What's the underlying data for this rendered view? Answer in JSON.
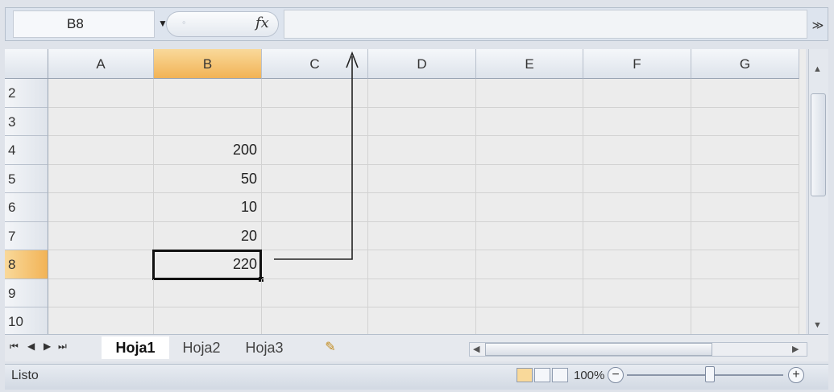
{
  "formula_bar": {
    "name_box": "B8",
    "fx_label": "fx",
    "formula": "",
    "expand": "≫"
  },
  "columns": [
    "A",
    "B",
    "C",
    "D",
    "E",
    "F",
    "G"
  ],
  "selected_column": "B",
  "rows": [
    {
      "num": "2",
      "b": ""
    },
    {
      "num": "3",
      "b": ""
    },
    {
      "num": "4",
      "b": "200"
    },
    {
      "num": "5",
      "b": "50"
    },
    {
      "num": "6",
      "b": "10"
    },
    {
      "num": "7",
      "b": "20"
    },
    {
      "num": "8",
      "b": "220"
    },
    {
      "num": "9",
      "b": ""
    },
    {
      "num": "10",
      "b": ""
    }
  ],
  "selected_row": "8",
  "sheet_tabs": [
    "Hoja1",
    "Hoja2",
    "Hoja3"
  ],
  "active_tab": "Hoja1",
  "status": {
    "text": "Listo",
    "zoom": "100%"
  }
}
